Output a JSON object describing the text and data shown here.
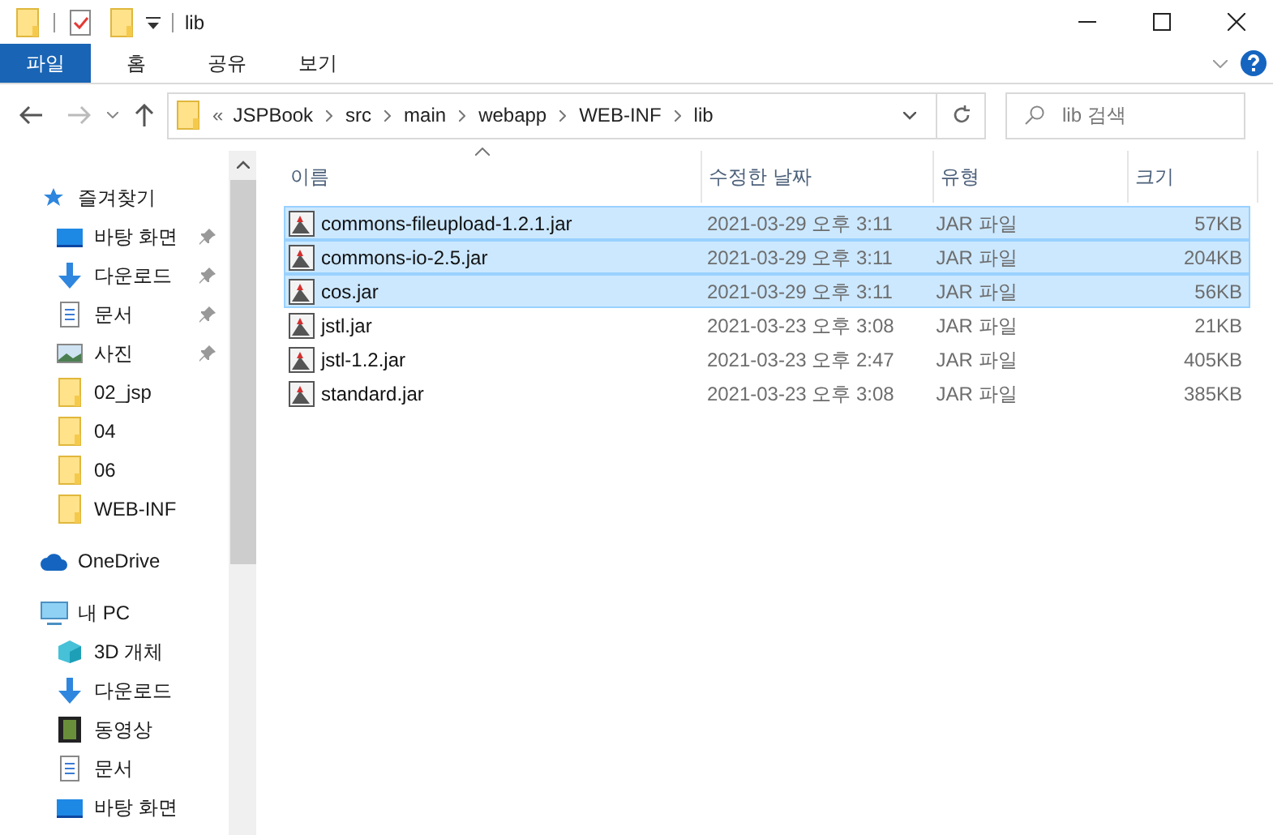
{
  "window": {
    "title": "lib"
  },
  "ribbon": {
    "tabs": [
      {
        "label": "파일",
        "selected": true
      },
      {
        "label": "홈",
        "selected": false
      },
      {
        "label": "공유",
        "selected": false
      },
      {
        "label": "보기",
        "selected": false
      }
    ]
  },
  "address": {
    "overflow": "«",
    "segments": [
      "JSPBook",
      "src",
      "main",
      "webapp",
      "WEB-INF",
      "lib"
    ]
  },
  "search": {
    "placeholder": "lib 검색"
  },
  "sidebar": {
    "items": [
      {
        "label": "즐겨찾기",
        "kind": "star",
        "children": [
          {
            "label": "바탕 화면",
            "kind": "desktop",
            "pinned": true
          },
          {
            "label": "다운로드",
            "kind": "download",
            "pinned": true
          },
          {
            "label": "문서",
            "kind": "document",
            "pinned": true
          },
          {
            "label": "사진",
            "kind": "photo",
            "pinned": true
          },
          {
            "label": "02_jsp",
            "kind": "folder",
            "pinned": false
          },
          {
            "label": "04",
            "kind": "folder",
            "pinned": false
          },
          {
            "label": "06",
            "kind": "folder",
            "pinned": false
          },
          {
            "label": "WEB-INF",
            "kind": "folder",
            "pinned": false
          }
        ]
      },
      {
        "label": "OneDrive",
        "kind": "cloud"
      },
      {
        "label": "내 PC",
        "kind": "pc",
        "children": [
          {
            "label": "3D 개체",
            "kind": "cube",
            "pinned": false
          },
          {
            "label": "다운로드",
            "kind": "download",
            "pinned": false
          },
          {
            "label": "동영상",
            "kind": "video",
            "pinned": false
          },
          {
            "label": "문서",
            "kind": "document",
            "pinned": false
          },
          {
            "label": "바탕 화면",
            "kind": "desktop",
            "pinned": false
          }
        ]
      }
    ]
  },
  "table": {
    "columns": [
      "이름",
      "수정한 날짜",
      "유형",
      "크기"
    ],
    "rows": [
      {
        "name": "commons-fileupload-1.2.1.jar",
        "date": "2021-03-29 오후 3:11",
        "type": "JAR 파일",
        "size": "57KB",
        "selected": true
      },
      {
        "name": "commons-io-2.5.jar",
        "date": "2021-03-29 오후 3:11",
        "type": "JAR 파일",
        "size": "204KB",
        "selected": true
      },
      {
        "name": "cos.jar",
        "date": "2021-03-29 오후 3:11",
        "type": "JAR 파일",
        "size": "56KB",
        "selected": true
      },
      {
        "name": "jstl.jar",
        "date": "2021-03-23 오후 3:08",
        "type": "JAR 파일",
        "size": "21KB",
        "selected": false
      },
      {
        "name": "jstl-1.2.jar",
        "date": "2021-03-23 오후 2:47",
        "type": "JAR 파일",
        "size": "405KB",
        "selected": false
      },
      {
        "name": "standard.jar",
        "date": "2021-03-23 오후 3:08",
        "type": "JAR 파일",
        "size": "385KB",
        "selected": false
      }
    ]
  }
}
